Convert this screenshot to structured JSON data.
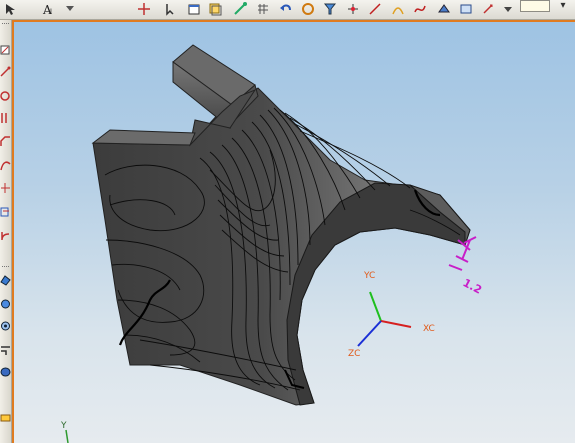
{
  "toolbar": {
    "icons": [
      "select-icon",
      "text-icon",
      "move-icon",
      "window-icon",
      "layer-icon",
      "snap-icon",
      "undo-icon",
      "refresh-icon",
      "filter-icon",
      "point-icon",
      "line-icon",
      "arc-icon",
      "curve-icon",
      "shaded-icon",
      "wireframe-icon",
      "help-icon"
    ],
    "combo_value": ""
  },
  "left_toolbar": {
    "icons": [
      "sketch-icon",
      "line-icon",
      "arc-icon",
      "circle-icon",
      "fillet-icon",
      "chamfer-icon",
      "trim-icon",
      "offset-icon",
      "dimension-icon",
      "constraint-icon",
      "extrude-icon",
      "revolve-icon",
      "hole-icon",
      "shell-icon",
      "blend-icon",
      "measure-icon"
    ]
  },
  "viewport": {
    "accent": "#e07b1f",
    "model": "shaded-surface-part",
    "datum_csys": {
      "x_label": "XC",
      "y_label": "YC",
      "z_label": "ZC",
      "colors": {
        "x": "#d62020",
        "y": "#1fbf1f",
        "z": "#1a2fd6"
      }
    },
    "wcs_label": "Y",
    "dimension": {
      "text": "1.2",
      "color": "#c81ec8"
    }
  }
}
